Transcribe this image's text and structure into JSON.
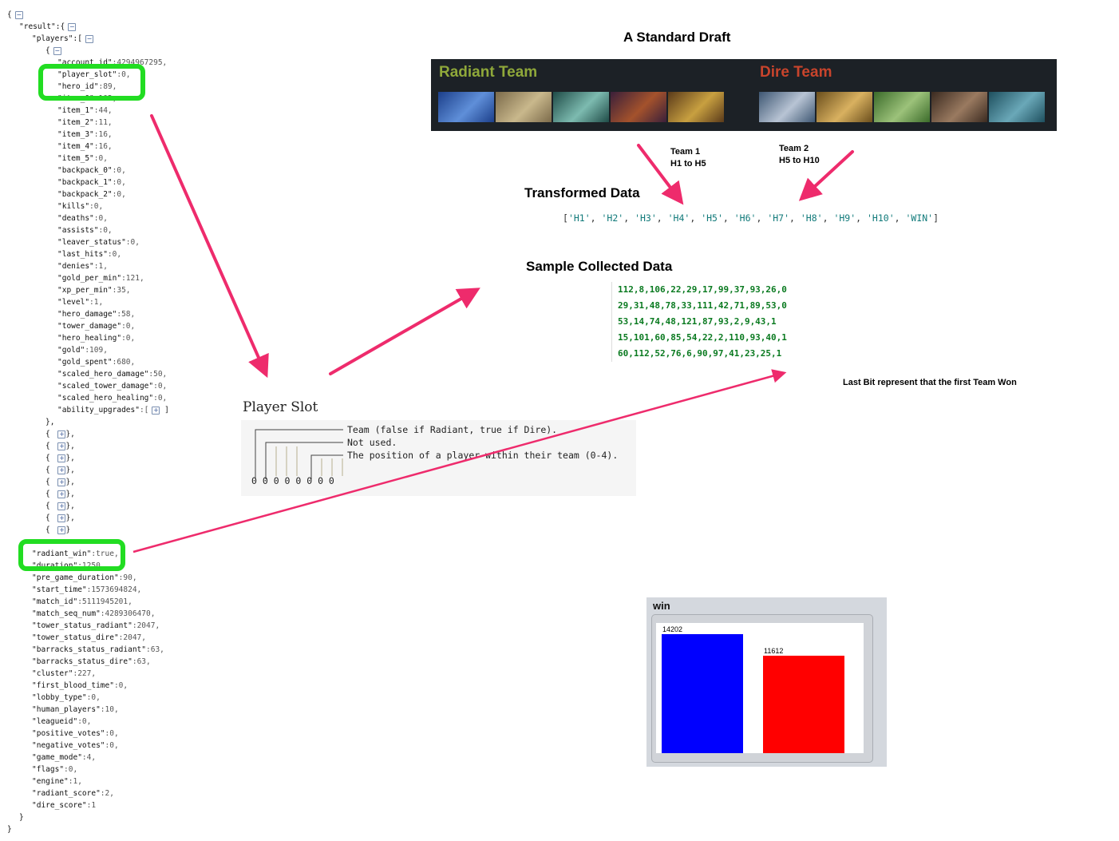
{
  "json_tree": {
    "open_brace": "{",
    "result_key": "\"result\":{",
    "players_key": "\"players\":[",
    "player_open": "{",
    "player_fields": [
      [
        "\"account_id\"",
        ":4294967295,"
      ],
      [
        "\"player_slot\"",
        ":0,"
      ],
      [
        "\"hero_id\"",
        ":89,"
      ],
      [
        "\"item_0\"",
        ":102,"
      ],
      [
        "\"item_1\"",
        ":44,"
      ],
      [
        "\"item_2\"",
        ":11,"
      ],
      [
        "\"item_3\"",
        ":16,"
      ],
      [
        "\"item_4\"",
        ":16,"
      ],
      [
        "\"item_5\"",
        ":0,"
      ],
      [
        "\"backpack_0\"",
        ":0,"
      ],
      [
        "\"backpack_1\"",
        ":0,"
      ],
      [
        "\"backpack_2\"",
        ":0,"
      ],
      [
        "\"kills\"",
        ":0,"
      ],
      [
        "\"deaths\"",
        ":0,"
      ],
      [
        "\"assists\"",
        ":0,"
      ],
      [
        "\"leaver_status\"",
        ":0,"
      ],
      [
        "\"last_hits\"",
        ":0,"
      ],
      [
        "\"denies\"",
        ":1,"
      ],
      [
        "\"gold_per_min\"",
        ":121,"
      ],
      [
        "\"xp_per_min\"",
        ":35,"
      ],
      [
        "\"level\"",
        ":1,"
      ],
      [
        "\"hero_damage\"",
        ":58,"
      ],
      [
        "\"tower_damage\"",
        ":0,"
      ],
      [
        "\"hero_healing\"",
        ":0,"
      ],
      [
        "\"gold\"",
        ":109,"
      ],
      [
        "\"gold_spent\"",
        ":680,"
      ],
      [
        "\"scaled_hero_damage\"",
        ":50,"
      ],
      [
        "\"scaled_tower_damage\"",
        ":0,"
      ],
      [
        "\"scaled_hero_healing\"",
        ":0,"
      ],
      [
        "\"ability_upgrades\"",
        ":["
      ]
    ],
    "player_close": "},",
    "collapsed_players": [
      "{ ",
      "{ ",
      "{ ",
      "{ ",
      "{ ",
      "{ ",
      "{ ",
      "{ ",
      "{ "
    ],
    "collapsed_suffix": [
      "},",
      "},",
      "},",
      "},",
      "},",
      "},",
      "},",
      "},",
      "}"
    ],
    "result_fields": [
      [
        "\"radiant_win\"",
        ":true,"
      ],
      [
        "\"duration\"",
        ":1250,"
      ],
      [
        "\"pre_game_duration\"",
        ":90,"
      ],
      [
        "\"start_time\"",
        ":1573694824,"
      ],
      [
        "\"match_id\"",
        ":5111945201,"
      ],
      [
        "\"match_seq_num\"",
        ":4289306470,"
      ],
      [
        "\"tower_status_radiant\"",
        ":2047,"
      ],
      [
        "\"tower_status_dire\"",
        ":2047,"
      ],
      [
        "\"barracks_status_radiant\"",
        ":63,"
      ],
      [
        "\"barracks_status_dire\"",
        ":63,"
      ],
      [
        "\"cluster\"",
        ":227,"
      ],
      [
        "\"first_blood_time\"",
        ":0,"
      ],
      [
        "\"lobby_type\"",
        ":0,"
      ],
      [
        "\"human_players\"",
        ":10,"
      ],
      [
        "\"leagueid\"",
        ":0,"
      ],
      [
        "\"positive_votes\"",
        ":0,"
      ],
      [
        "\"negative_votes\"",
        ":0,"
      ],
      [
        "\"game_mode\"",
        ":4,"
      ],
      [
        "\"flags\"",
        ":0,"
      ],
      [
        "\"engine\"",
        ":1,"
      ],
      [
        "\"radiant_score\"",
        ":2,"
      ],
      [
        "\"dire_score\"",
        ":1"
      ]
    ],
    "result_close": "}",
    "root_close": "}"
  },
  "draft": {
    "title": "A Standard Draft",
    "radiant_label": "Radiant Team",
    "dire_label": "Dire Team",
    "radiant_color": "#8fa83a",
    "dire_color": "#c8442c",
    "radiant_heroes": [
      {
        "icon": "hero-portrait-icon",
        "colors": [
          "#1c3f8a",
          "#5f8fd9"
        ]
      },
      {
        "icon": "hero-portrait-icon",
        "colors": [
          "#7b6a4a",
          "#c9b88c"
        ]
      },
      {
        "icon": "hero-portrait-icon",
        "colors": [
          "#1f4b47",
          "#7dbbb0"
        ]
      },
      {
        "icon": "hero-portrait-icon",
        "colors": [
          "#3a1f3a",
          "#a4522c"
        ]
      },
      {
        "icon": "hero-portrait-icon",
        "colors": [
          "#5a3a1a",
          "#c8a040"
        ]
      }
    ],
    "dire_heroes": [
      {
        "icon": "hero-portrait-icon",
        "colors": [
          "#3d5672",
          "#b8c4d4"
        ]
      },
      {
        "icon": "hero-portrait-icon",
        "colors": [
          "#6a4e1c",
          "#d9b160"
        ]
      },
      {
        "icon": "hero-portrait-icon",
        "colors": [
          "#3b6b2a",
          "#9cc27a"
        ]
      },
      {
        "icon": "hero-portrait-icon",
        "colors": [
          "#3a2a20",
          "#9a7a60"
        ]
      },
      {
        "icon": "hero-portrait-icon",
        "colors": [
          "#1e4f5e",
          "#6aa8b8"
        ]
      }
    ]
  },
  "team_notes": {
    "team1": "Team 1\nH1 to H5",
    "team2": "Team 2\nH5 to H10"
  },
  "transformed": {
    "title": "Transformed Data",
    "open": "[",
    "items": [
      "'H1'",
      "'H2'",
      "'H3'",
      "'H4'",
      "'H5'",
      "'H6'",
      "'H7'",
      "'H8'",
      "'H9'",
      "'H10'",
      "'WIN'"
    ],
    "close": "]"
  },
  "sample": {
    "title": "Sample Collected Data",
    "rows": [
      "112,8,106,22,29,17,99,37,93,26,0",
      "29,31,48,78,33,111,42,71,89,53,0",
      "53,14,74,48,121,87,93,2,9,43,1",
      "15,101,60,85,54,22,2,110,93,40,1",
      "60,112,52,76,6,90,97,41,23,25,1"
    ],
    "note": "Last Bit represent that the first Team Won"
  },
  "player_slot": {
    "title": "Player Slot",
    "lines": [
      "Team (false if Radiant, true if Dire).",
      "Not used.",
      "The position of a player within their team (0-4)."
    ],
    "bits": "0 0 0 0 0 0 0 0"
  },
  "chart_data": {
    "type": "bar",
    "title": "win",
    "categories": [
      "",
      ""
    ],
    "values": [
      14202,
      11612
    ],
    "colors": [
      "#0000ff",
      "#ff0000"
    ],
    "ylim": [
      0,
      15500
    ],
    "grid": false
  }
}
